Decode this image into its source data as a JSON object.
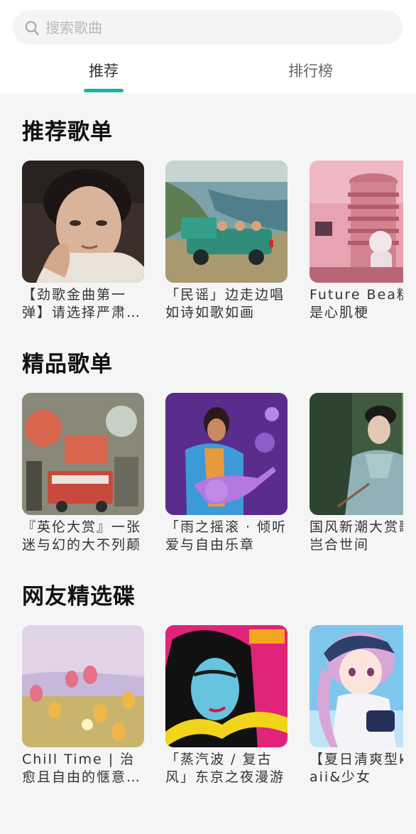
{
  "search": {
    "placeholder": "搜索歌曲"
  },
  "tabs": [
    {
      "label": "推荐",
      "active": true
    },
    {
      "label": "排行榜",
      "active": false
    }
  ],
  "accent_color": "#14b3a4",
  "sections": [
    {
      "title": "推荐歌单",
      "playlists": [
        {
          "title": "【劲歌金曲第一弹】请选择严肃收听",
          "cover": "portrait-photo"
        },
        {
          "title": "「民谣」边走边唱如诗如歌如画",
          "cover": "illustrated-car-coast"
        },
        {
          "title": "Future Bea糕，是心肌梗",
          "cover": "pink-tower-astronaut"
        }
      ]
    },
    {
      "title": "精品歌单",
      "playlists": [
        {
          "title": "『英伦大赏』一张迷与幻的大不列颠",
          "cover": "london-bus-illustration"
        },
        {
          "title": "「雨之摇滚 · 倾听爱与自由乐章",
          "cover": "purple-guitarist"
        },
        {
          "title": "国风新潮大赏歌声岂合世间",
          "cover": "hanfu-portrait"
        }
      ]
    },
    {
      "title": "网友精选碟",
      "playlists": [
        {
          "title": "Chill Time | 治愈且自由的惬意时光",
          "cover": "tulip-field"
        },
        {
          "title": "「蒸汽波 / 复古风」东京之夜漫游",
          "cover": "retro-city-pop"
        },
        {
          "title": "【夏日清爽型kawaii&少女",
          "cover": "anime-girl"
        }
      ]
    }
  ]
}
